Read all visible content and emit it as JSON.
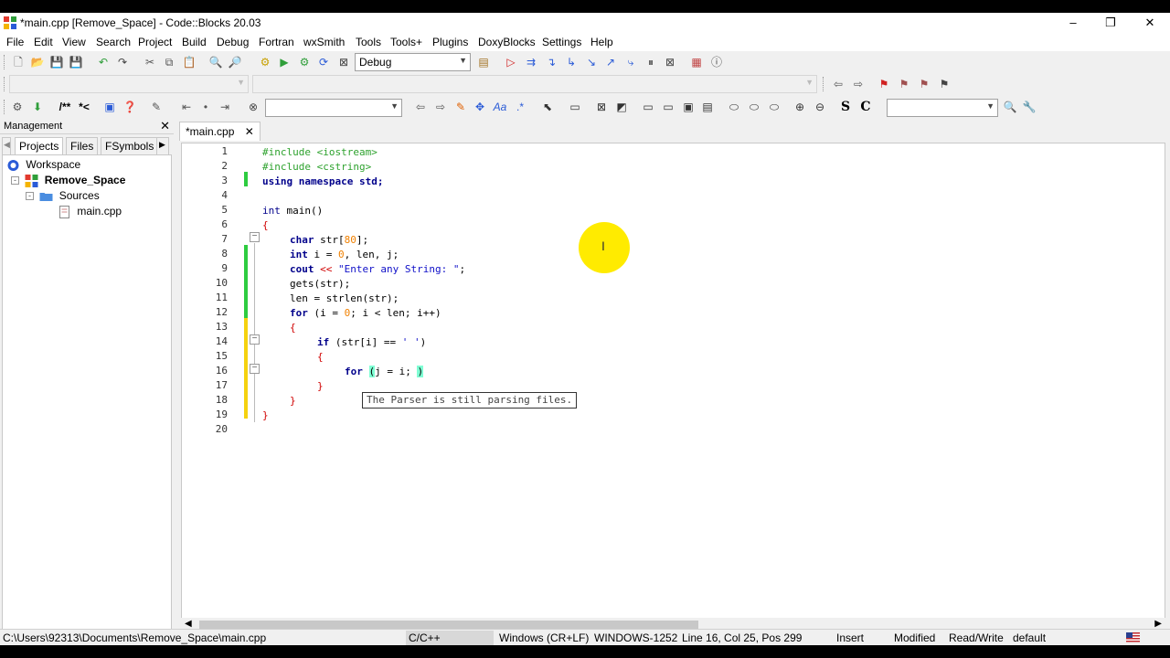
{
  "window": {
    "title": "*main.cpp [Remove_Space] - Code::Blocks 20.03",
    "minimize": "–",
    "restore": "❐",
    "close": "✕"
  },
  "menu": [
    "File",
    "Edit",
    "View",
    "Search",
    "Project",
    "Build",
    "Debug",
    "Fortran",
    "wxSmith",
    "Tools",
    "Tools+",
    "Plugins",
    "DoxyBlocks",
    "Settings",
    "Help"
  ],
  "toolbar": {
    "build_target": "Debug",
    "doc_blocks": [
      "/**",
      "*<"
    ],
    "letters": [
      "S",
      "C"
    ]
  },
  "management": {
    "title": "Management",
    "close": "✕",
    "tabs": [
      "Projects",
      "Files",
      "FSymbols"
    ],
    "tree": {
      "workspace": "Workspace",
      "project": "Remove_Space",
      "folder": "Sources",
      "file": "main.cpp"
    }
  },
  "editor": {
    "tab_label": "*main.cpp",
    "tab_close": "✕",
    "line_numbers": [
      "1",
      "2",
      "3",
      "4",
      "5",
      "6",
      "7",
      "8",
      "9",
      "10",
      "11",
      "12",
      "13",
      "14",
      "15",
      "16",
      "17",
      "18",
      "19",
      "20"
    ],
    "tooltip": "The Parser is still parsing files."
  },
  "code": {
    "l1": "#include <iostream>",
    "l2": "#include <cstring>",
    "l3a": "using namespace",
    "l3b": " std;",
    "l5a": "int",
    "l5b": " main()",
    "l6": "{",
    "l7a": "char",
    "l7b": " str[",
    "l7c": "80",
    "l7d": "];",
    "l8a": "int",
    "l8b": " i = ",
    "l8c": "0",
    "l8d": ", len, j;",
    "l9a": "cout ",
    "l9b": "<<",
    "l9c": " ",
    "l9d": "\"Enter any String: \"",
    "l9e": ";",
    "l10": "gets(str);",
    "l11": "len = strlen(str);",
    "l12a": "for",
    "l12b": " (i = ",
    "l12c": "0",
    "l12d": "; i < len; i++)",
    "l13": "{",
    "l14a": "if",
    "l14b": " (str[i] == ",
    "l14c": "' '",
    "l14d": ")",
    "l15": "{",
    "l16a": "for",
    "l16b": " ",
    "l16c": "(",
    "l16d": "j = i; ",
    "l16e": ")",
    "l17": "}",
    "l18": "}",
    "l19": "}"
  },
  "statusbar": {
    "path": "C:\\Users\\92313\\Documents\\Remove_Space\\main.cpp",
    "language": "C/C++",
    "eol": "Windows (CR+LF)",
    "encoding": "WINDOWS-1252",
    "position": "Line 16, Col 25, Pos 299",
    "mode": "Insert",
    "modified": "Modified",
    "access": "Read/Write",
    "profile": "default"
  },
  "colors": {
    "preprocessor": "#2ea22e",
    "keyword": "#00008b",
    "number": "#f08000",
    "string": "#1010c8",
    "change_saved": "#2ecc40",
    "change_unsaved": "#f5d20f",
    "cursor_highlight": "#ffeb00"
  }
}
